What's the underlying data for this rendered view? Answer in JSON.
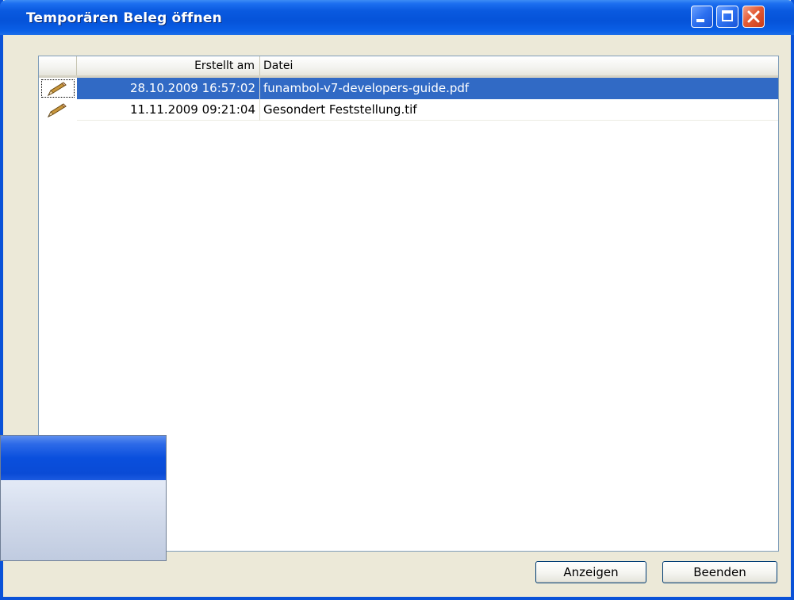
{
  "window": {
    "title": "Temporären Beleg öffnen"
  },
  "list": {
    "columns": {
      "created": "Erstellt am",
      "file": "Datei"
    },
    "rows": [
      {
        "icon": "pencil-icon",
        "created": "28.10.2009 16:57:02",
        "file": "funambol-v7-developers-guide.pdf",
        "selected": true
      },
      {
        "icon": "pencil-icon",
        "created": "11.11.2009 09:21:04",
        "file": "Gesondert Feststellung.tif",
        "selected": false
      }
    ]
  },
  "buttons": {
    "show": "Anzeigen",
    "close": "Beenden"
  },
  "colors": {
    "titlebar": "#0553d9",
    "selection": "#316ac5",
    "close_button": "#e45b35"
  }
}
